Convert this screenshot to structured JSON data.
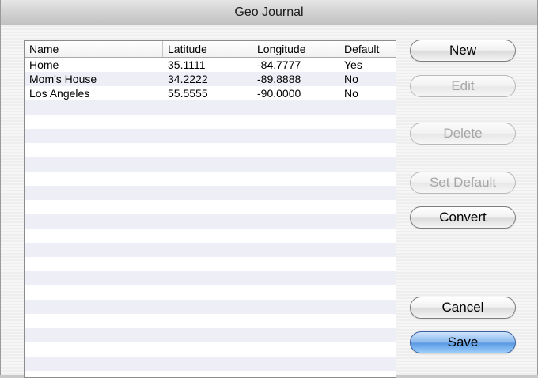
{
  "window": {
    "title": "Geo Journal"
  },
  "table": {
    "columns": [
      "Name",
      "Latitude",
      "Longitude",
      "Default"
    ],
    "rows": [
      {
        "name": "Home",
        "latitude": "35.1111",
        "longitude": "-84.7777",
        "default": "Yes"
      },
      {
        "name": "Mom's House",
        "latitude": "34.2222",
        "longitude": "-89.8888",
        "default": "No"
      },
      {
        "name": "Los Angeles",
        "latitude": "55.5555",
        "longitude": "-90.0000",
        "default": "No"
      }
    ]
  },
  "buttons": {
    "new": {
      "label": "New",
      "enabled": true
    },
    "edit": {
      "label": "Edit",
      "enabled": false
    },
    "delete": {
      "label": "Delete",
      "enabled": false
    },
    "set_default": {
      "label": "Set Default",
      "enabled": false
    },
    "convert": {
      "label": "Convert",
      "enabled": true
    },
    "cancel": {
      "label": "Cancel",
      "enabled": true
    },
    "save": {
      "label": "Save",
      "enabled": true,
      "is_default": true
    }
  },
  "colors": {
    "row_alt": "#edeef6",
    "default_button": "#5b9be4",
    "disabled_text": "#a6a6a6"
  }
}
